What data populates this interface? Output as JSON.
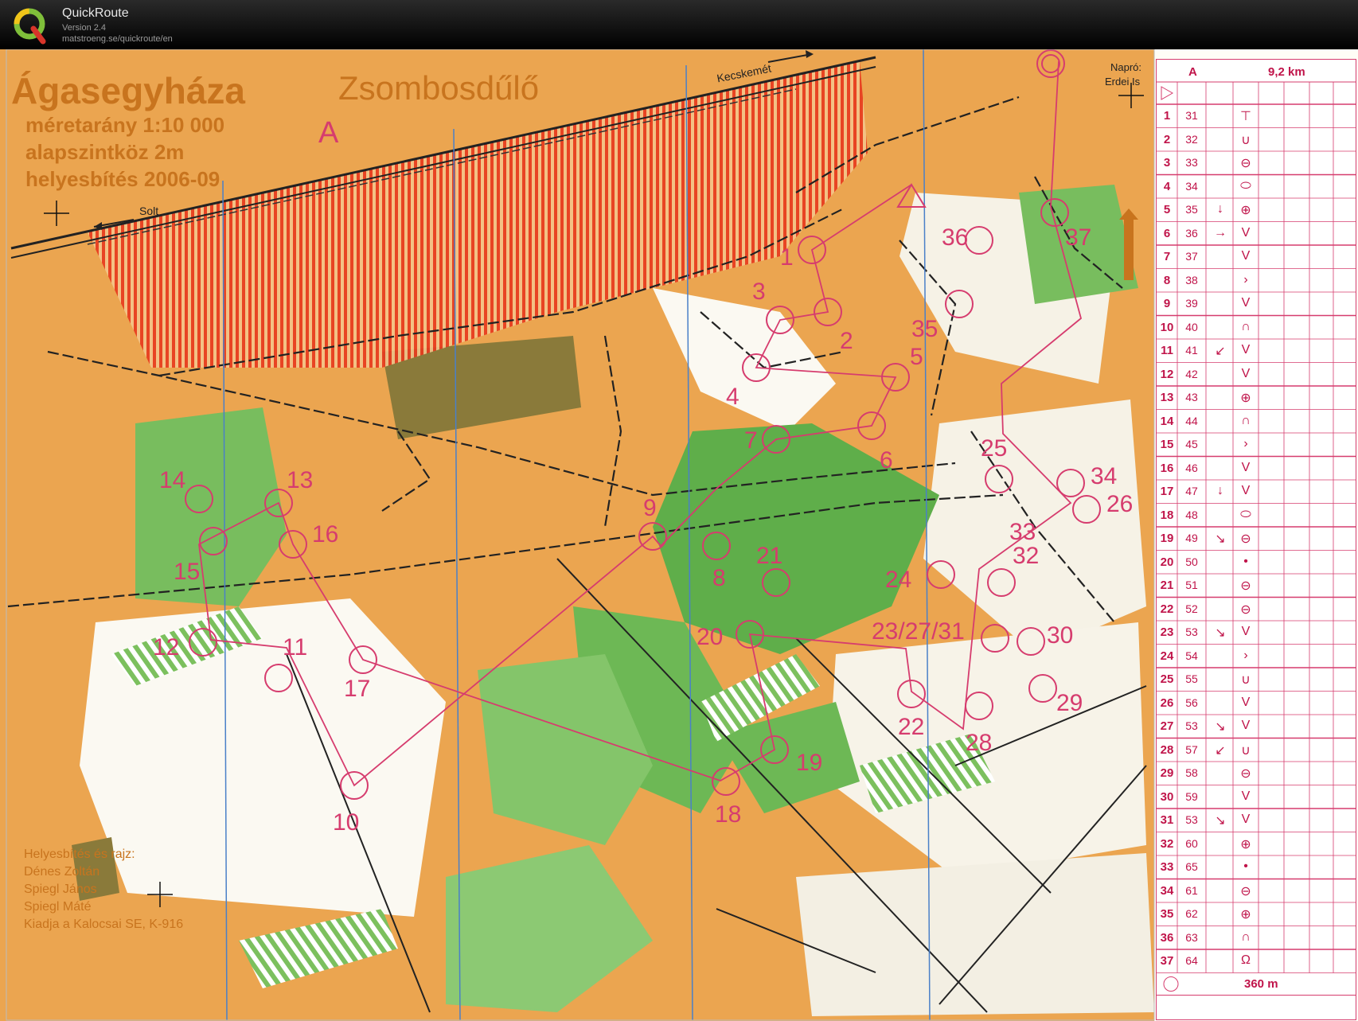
{
  "app": {
    "title": "QuickRoute",
    "version": "Version 2.4",
    "url": "matstroeng.se/quickroute/en"
  },
  "map": {
    "title": "Ágasegyháza",
    "subtitle": "Zsombosdűlő",
    "course": "A",
    "scale": "méretarány  1:10 000",
    "contour": "alapszintköz  2m",
    "revision": "helyesbítés  2006-09",
    "road_west": "Solt",
    "road_east": "Kecskemét",
    "napro": "Napró:",
    "erdei": "Erdei Is",
    "credits": [
      "Helyesbítés és rajz:",
      "Dénes Zoltán",
      "Spiegl János",
      "Spiegl Máté",
      "Kiadja a Kalocsai SE, K-916"
    ],
    "controls": [
      "1",
      "2",
      "3",
      "4",
      "5",
      "6",
      "7",
      "8",
      "9",
      "10",
      "11",
      "12",
      "13",
      "14",
      "15",
      "16",
      "17",
      "18",
      "19",
      "20",
      "21",
      "22",
      "23/27/31",
      "24",
      "25",
      "26",
      "28",
      "29",
      "30",
      "32",
      "33",
      "34",
      "35",
      "36",
      "37"
    ],
    "colors": {
      "course": "#d63c6e",
      "open": "#e9a04a",
      "forest": "#5fae4a",
      "brown": "#c8741e",
      "forbidden": "#e8391e"
    }
  },
  "description": {
    "course": "A",
    "length": "9,2 km",
    "finish": "360 m",
    "rows": [
      {
        "n": "1",
        "c": "31",
        "dir": "",
        "sym": "⊤"
      },
      {
        "n": "2",
        "c": "32",
        "dir": "",
        "sym": "∪"
      },
      {
        "n": "3",
        "c": "33",
        "dir": "",
        "sym": "⊖"
      },
      {
        "n": "4",
        "c": "34",
        "dir": "",
        "sym": "⬭"
      },
      {
        "n": "5",
        "c": "35",
        "dir": "↓",
        "sym": "⊕"
      },
      {
        "n": "6",
        "c": "36",
        "dir": "→",
        "sym": "V"
      },
      {
        "n": "7",
        "c": "37",
        "dir": "",
        "sym": "V"
      },
      {
        "n": "8",
        "c": "38",
        "dir": "",
        "sym": "›"
      },
      {
        "n": "9",
        "c": "39",
        "dir": "",
        "sym": "V"
      },
      {
        "n": "10",
        "c": "40",
        "dir": "",
        "sym": "∩"
      },
      {
        "n": "11",
        "c": "41",
        "dir": "↙",
        "sym": "V"
      },
      {
        "n": "12",
        "c": "42",
        "dir": "",
        "sym": "V"
      },
      {
        "n": "13",
        "c": "43",
        "dir": "",
        "sym": "⊕"
      },
      {
        "n": "14",
        "c": "44",
        "dir": "",
        "sym": "∩"
      },
      {
        "n": "15",
        "c": "45",
        "dir": "",
        "sym": "›"
      },
      {
        "n": "16",
        "c": "46",
        "dir": "",
        "sym": "V"
      },
      {
        "n": "17",
        "c": "47",
        "dir": "↓",
        "sym": "V"
      },
      {
        "n": "18",
        "c": "48",
        "dir": "",
        "sym": "⬭"
      },
      {
        "n": "19",
        "c": "49",
        "dir": "↘",
        "sym": "⊖"
      },
      {
        "n": "20",
        "c": "50",
        "dir": "",
        "sym": "•"
      },
      {
        "n": "21",
        "c": "51",
        "dir": "",
        "sym": "⊖"
      },
      {
        "n": "22",
        "c": "52",
        "dir": "",
        "sym": "⊖"
      },
      {
        "n": "23",
        "c": "53",
        "dir": "↘",
        "sym": "V"
      },
      {
        "n": "24",
        "c": "54",
        "dir": "",
        "sym": "›"
      },
      {
        "n": "25",
        "c": "55",
        "dir": "",
        "sym": "∪"
      },
      {
        "n": "26",
        "c": "56",
        "dir": "",
        "sym": "V"
      },
      {
        "n": "27",
        "c": "53",
        "dir": "↘",
        "sym": "V"
      },
      {
        "n": "28",
        "c": "57",
        "dir": "↙",
        "sym": "∪"
      },
      {
        "n": "29",
        "c": "58",
        "dir": "",
        "sym": "⊖"
      },
      {
        "n": "30",
        "c": "59",
        "dir": "",
        "sym": "V"
      },
      {
        "n": "31",
        "c": "53",
        "dir": "↘",
        "sym": "V"
      },
      {
        "n": "32",
        "c": "60",
        "dir": "",
        "sym": "⊕"
      },
      {
        "n": "33",
        "c": "65",
        "dir": "",
        "sym": "•"
      },
      {
        "n": "34",
        "c": "61",
        "dir": "",
        "sym": "⊖"
      },
      {
        "n": "35",
        "c": "62",
        "dir": "",
        "sym": "⊕"
      },
      {
        "n": "36",
        "c": "63",
        "dir": "",
        "sym": "∩"
      },
      {
        "n": "37",
        "c": "64",
        "dir": "",
        "sym": "Ω"
      }
    ]
  }
}
